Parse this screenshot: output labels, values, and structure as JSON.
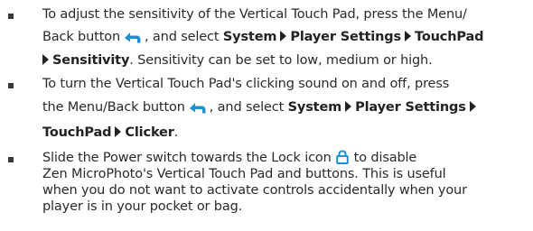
{
  "bullets": [
    {
      "lines": {
        "l1": "To adjust the sensitivity of the Vertical Touch Pad, press the Menu/",
        "l2_pre": "Back button",
        "l2_post": ", and select",
        "menu_system": "System",
        "menu_player_settings": "Player Settings",
        "menu_touchpad": "TouchPad",
        "menu_sensitivity": "Sensitivity",
        "l3_post": ". Sensitivity can be set to low, medium or high."
      }
    },
    {
      "lines": {
        "l1": "To turn the Vertical Touch Pad's clicking sound on and off, press",
        "l2_pre": "the Menu/Back button",
        "l2_post": ", and select",
        "menu_system": "System",
        "menu_player_settings": "Player Settings",
        "menu_touchpad": "TouchPad",
        "menu_clicker": "Clicker",
        "l3_post": "."
      }
    },
    {
      "lines": {
        "l1_pre": "Slide the Power switch towards the Lock icon",
        "l1_post": "to disable",
        "l2": "Zen MicroPhoto's Vertical Touch Pad and buttons. This is useful",
        "l3": "when you do not want to activate controls accidentally when your",
        "l4": "player is in your pocket or bag."
      }
    }
  ],
  "icons": {
    "menu_back": "menu-back-icon",
    "menu_arrow": "menu-arrow-icon",
    "lock": "lock-icon"
  },
  "colors": {
    "icon_blue": "#1d8fd2",
    "text": "#2a2a2a"
  }
}
